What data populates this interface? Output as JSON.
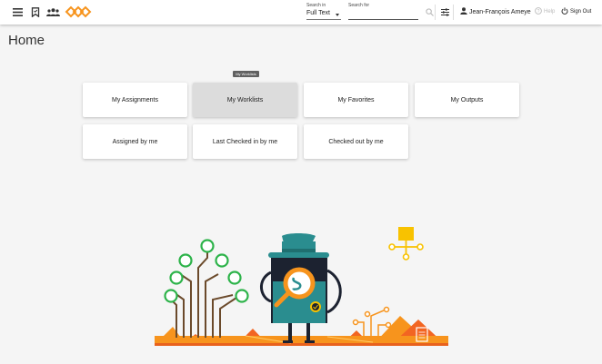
{
  "header": {
    "search_in_label": "Search in",
    "search_in_value": "Full Text",
    "search_for_label": "Search for",
    "search_for_value": "",
    "user_name": "Jean-François Ameye",
    "help_label": "Help",
    "signout_label": "Sign Out"
  },
  "page": {
    "title": "Home"
  },
  "tooltip": {
    "text": "My Worklists"
  },
  "cards": [
    {
      "label": "My Assignments"
    },
    {
      "label": "My Worklists"
    },
    {
      "label": "My Favorites"
    },
    {
      "label": "My Outputs"
    },
    {
      "label": "Assigned by me"
    },
    {
      "label": "Last Checked in by me"
    },
    {
      "label": "Checked out by me"
    }
  ],
  "icons": [
    "menu-icon",
    "bookmark-icon",
    "people-icon",
    "logo",
    "search-icon",
    "filter-settings-icon",
    "person-icon",
    "help-icon",
    "power-icon"
  ],
  "colors": {
    "accent_orange": "#f7941d",
    "teal": "#2a8d8f",
    "green": "#2db34a",
    "brown": "#6b4a2b",
    "yellow": "#f8c200"
  }
}
